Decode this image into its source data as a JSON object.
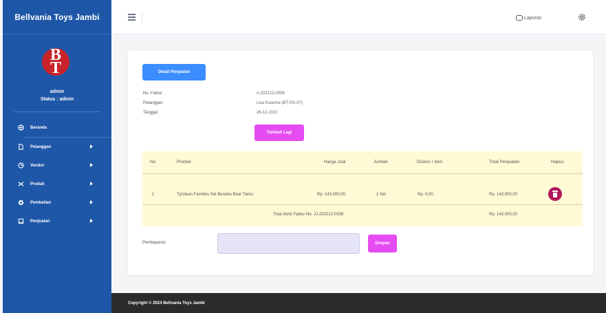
{
  "sidebar": {
    "brand": "Bellvania Toys Jambi",
    "avatar_text": [
      "B",
      "T"
    ],
    "user_name": "admin",
    "user_status": "Status : admin",
    "items": [
      {
        "label": "Beranda",
        "icon": "dashboard-icon",
        "has_submenu": false
      },
      {
        "label": "Pelanggan",
        "icon": "file-icon",
        "has_submenu": true
      },
      {
        "label": "Vendor",
        "icon": "user-icon",
        "has_submenu": true
      },
      {
        "label": "Produk",
        "icon": "box-icon",
        "has_submenu": true
      },
      {
        "label": "Pembelian",
        "icon": "cart-icon",
        "has_submenu": true
      },
      {
        "label": "Penjualan",
        "icon": "receipt-icon",
        "has_submenu": true
      }
    ],
    "color": "#1f57a8"
  },
  "topbar": {
    "laporan_label": "Laporan"
  },
  "main": {
    "detail_button": "Detail Penjualan",
    "meta": {
      "no_faktur_label": "No. Faktur",
      "no_faktur_value": "n-202212-0008",
      "pelanggan_label": "Pelanggan",
      "pelanggan_value": "Lisa Kusuma (BT-PG-07)",
      "tanggal_label": "Tanggal",
      "tanggal_value": "26-12-2022"
    },
    "tambah_button": "Tambah Lagi",
    "table": {
      "headers": [
        "No",
        "Produk",
        "Harga Jual",
        "Jumlah",
        "Diskon / item",
        "Total Penjualan",
        "Hapus"
      ],
      "rows": [
        {
          "no": "1",
          "produk": "Tyrolean Families Set Beneka Bear Twins",
          "harga": "Rp. 143.000,00",
          "jumlah": "1 Set",
          "diskon": "Rp. 0,00",
          "total": "Rp. 143.000,00"
        }
      ],
      "footer_label": "Total Akhir Faktur No. JJ-202212-0008",
      "footer_total": "Rp. 143.000,00"
    },
    "pembayaran_label": "Pembayaran",
    "pembayaran_value": "",
    "simpan_button": "Simpan"
  },
  "footer": {
    "text": "Copyright © 2024 Bellvania Toys Jambi"
  },
  "colors": {
    "primary": "#3c8dff",
    "magenta": "#e54cf1",
    "table_bg": "#fff9d6",
    "delete": "#b0175c"
  }
}
